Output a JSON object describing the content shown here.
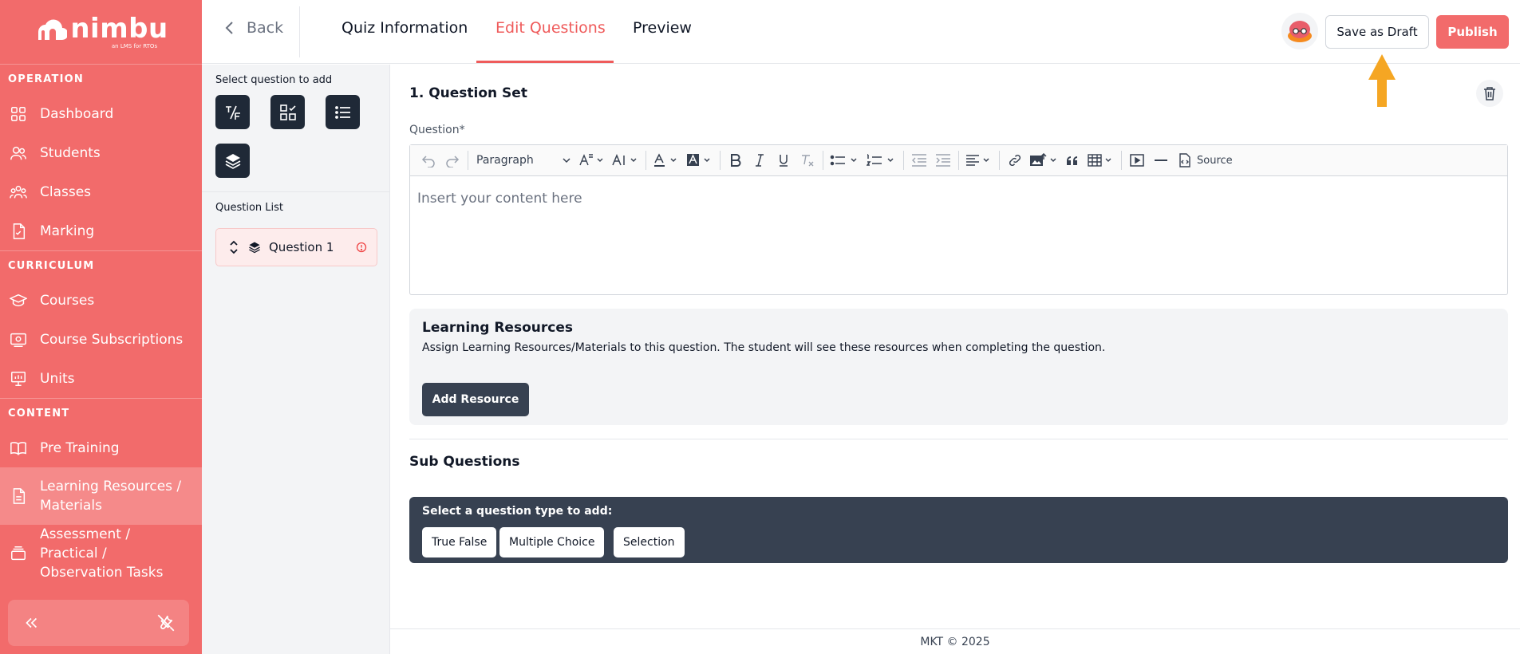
{
  "brand": {
    "name": "nimbu",
    "tagline": "an LMS for RTOs"
  },
  "sidebar": {
    "sections": [
      {
        "title": "OPERATION",
        "items": [
          {
            "label": "Dashboard",
            "icon": "grid-icon"
          },
          {
            "label": "Students",
            "icon": "users-icon"
          },
          {
            "label": "Classes",
            "icon": "group-icon"
          },
          {
            "label": "Marking",
            "icon": "checklist-icon"
          }
        ]
      },
      {
        "title": "CURRICULUM",
        "items": [
          {
            "label": "Courses",
            "icon": "graduation-cap-icon"
          },
          {
            "label": "Course Subscriptions",
            "icon": "certificate-icon"
          },
          {
            "label": "Units",
            "icon": "presentation-icon"
          }
        ]
      },
      {
        "title": "CONTENT",
        "items": [
          {
            "label": "Pre Training",
            "icon": "book-icon"
          },
          {
            "label": "Learning Resources / Materials",
            "icon": "document-icon",
            "active": true
          },
          {
            "label": "Assessment / Practical / Observation Tasks",
            "icon": "stack-icon"
          }
        ]
      }
    ]
  },
  "header": {
    "back_label": "Back",
    "tabs": [
      {
        "label": "Quiz Information"
      },
      {
        "label": "Edit Questions",
        "active": true
      },
      {
        "label": "Preview"
      }
    ],
    "save_draft_label": "Save as Draft",
    "publish_label": "Publish"
  },
  "palette": {
    "title": "Select question to add",
    "buttons": [
      "true-false-icon",
      "multiple-choice-icon",
      "list-icon",
      "layers-icon"
    ],
    "list_title": "Question List",
    "questions": [
      {
        "label": "Question 1"
      }
    ]
  },
  "question_set": {
    "title": "1. Question Set",
    "question_label": "Question*",
    "toolbar": {
      "paragraph": "Paragraph",
      "source": "Source"
    },
    "placeholder": "Insert your content here"
  },
  "learning_resources": {
    "title": "Learning Resources",
    "description": "Assign Learning Resources/Materials to this question. The student will see these resources when completing the question.",
    "add_label": "Add Resource"
  },
  "sub_questions": {
    "title": "Sub Questions",
    "prompt": "Select a question type to add:",
    "types": [
      "True False",
      "Multiple Choice",
      "Selection"
    ]
  },
  "footer": {
    "text": "MKT © 2025"
  },
  "colors": {
    "brand": "#f26b6b",
    "accent": "#ef5b5b",
    "dark": "#374151",
    "arrow": "#f5a623"
  }
}
